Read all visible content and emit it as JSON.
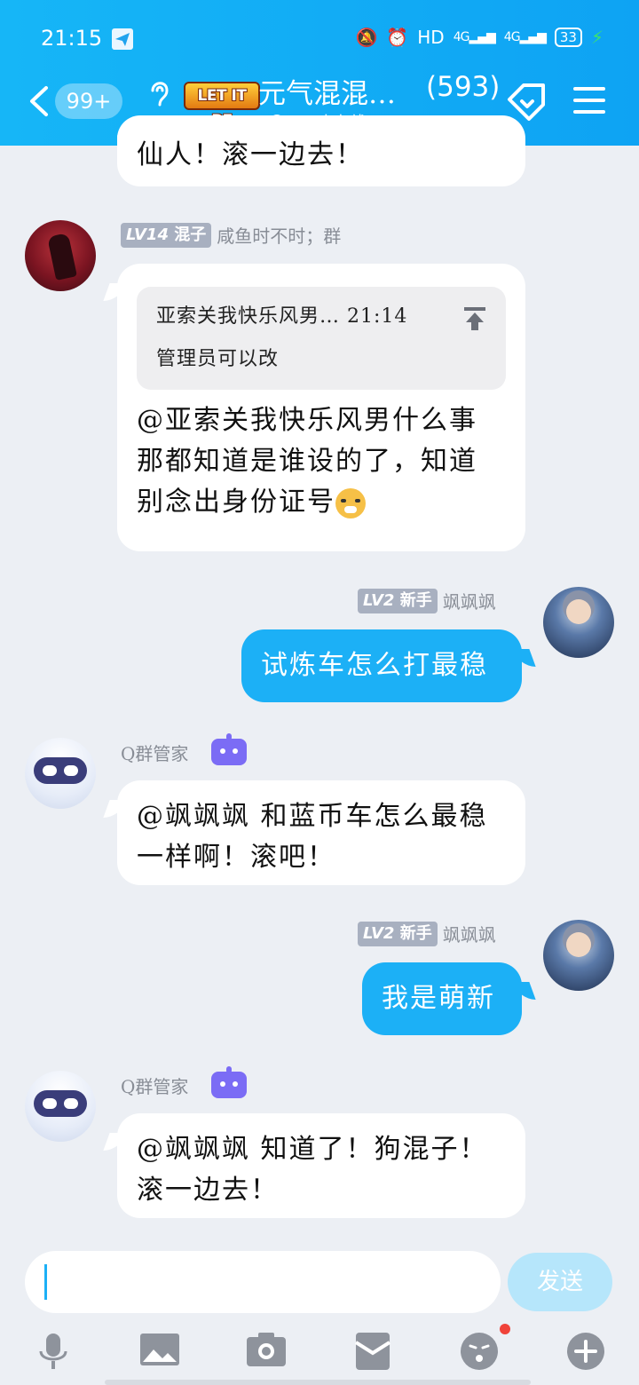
{
  "status_bar": {
    "time": "21:15",
    "network": "HD",
    "signal1": "4G",
    "signal2": "4G",
    "battery": "33"
  },
  "header": {
    "unread_badge": "99+",
    "group_logo_text": "LET IT BE",
    "group_name": "元气混混…",
    "member_count": "(593)",
    "online_text": "426人在线"
  },
  "messages": [
    {
      "id": "m0",
      "side": "left",
      "text": "仙人！滚一边去！"
    },
    {
      "id": "m1",
      "side": "left",
      "level": "LV14",
      "title": "混子",
      "sender": "咸鱼时不时；群",
      "quote": {
        "sender_time": "亚索关我快乐风男… 21:14",
        "text": "管理员可以改"
      },
      "lines": [
        "@亚索关我快乐风男什么事",
        "那都知道是谁设的了，知道",
        "别念出身份证号"
      ]
    },
    {
      "id": "m2",
      "side": "right",
      "level": "LV2",
      "title": "新手",
      "sender": "飒飒飒",
      "text": "试炼车怎么打最稳"
    },
    {
      "id": "m3",
      "side": "left",
      "sender": "Q群管家",
      "lines": [
        "@飒飒飒 和蓝币车怎么最稳",
        "一样啊！滚吧！"
      ]
    },
    {
      "id": "m4",
      "side": "right",
      "level": "LV2",
      "title": "新手",
      "sender": "飒飒飒",
      "text": "我是萌新"
    },
    {
      "id": "m5",
      "side": "left",
      "sender": "Q群管家",
      "lines": [
        "@飒飒飒 知道了！狗混子！",
        "滚一边去！"
      ]
    }
  ],
  "input": {
    "value": "",
    "send_label": "发送"
  },
  "toolbar": [
    "mic-icon",
    "image-icon",
    "camera-icon",
    "red-packet-icon",
    "emoji-icon",
    "plus-icon"
  ],
  "colors": {
    "header": "#0ea3f3",
    "bubble_self": "#1cb0f6",
    "send_disabled": "#b6e6fb"
  }
}
